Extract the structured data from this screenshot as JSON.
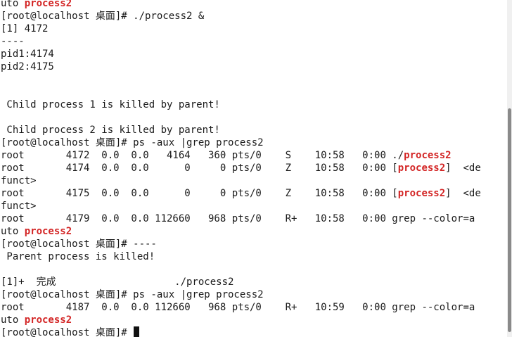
{
  "terminal": {
    "lines": [
      {
        "t": "uto ",
        "h": "process2"
      },
      {
        "t": "[root@localhost 桌面]# ./process2 &"
      },
      {
        "t": "[1] 4172"
      },
      {
        "t": "----"
      },
      {
        "t": "pid1:4174"
      },
      {
        "t": "pid2:4175"
      },
      {
        "t": ""
      },
      {
        "t": ""
      },
      {
        "t": " Child process 1 is killed by parent!"
      },
      {
        "t": ""
      },
      {
        "t": " Child process 2 is killed by parent!"
      },
      {
        "t": "[root@localhost 桌面]# ps -aux |grep process2"
      },
      {
        "t": "root       4172  0.0  0.0   4164   360 pts/0    S    10:58   0:00 ./",
        "h": "process2"
      },
      {
        "t": "root       4174  0.0  0.0      0     0 pts/0    Z    10:58   0:00 [",
        "h": "process2",
        "a": "]  <de"
      },
      {
        "t": "funct>"
      },
      {
        "t": "root       4175  0.0  0.0      0     0 pts/0    Z    10:58   0:00 [",
        "h": "process2",
        "a": "]  <de"
      },
      {
        "t": "funct>"
      },
      {
        "t": "root       4179  0.0  0.0 112660   968 pts/0    R+   10:58   0:00 grep --color=a"
      },
      {
        "t": "uto ",
        "h": "process2"
      },
      {
        "t": "[root@localhost 桌面]# ----"
      },
      {
        "t": " Parent process is killed!"
      },
      {
        "t": ""
      },
      {
        "t": "[1]+  完成                    ./process2"
      },
      {
        "t": "[root@localhost 桌面]# ps -aux |grep process2"
      },
      {
        "t": "root       4187  0.0  0.0 112660   968 pts/0    R+   10:59   0:00 grep --color=a"
      },
      {
        "t": "uto ",
        "h": "process2"
      },
      {
        "t": "[root@localhost 桌面]# ",
        "cursor": true
      }
    ]
  },
  "colors": {
    "background": "#ffffff",
    "text": "#1a1a1a",
    "highlight": "#d32525",
    "cursor": "#111111"
  }
}
